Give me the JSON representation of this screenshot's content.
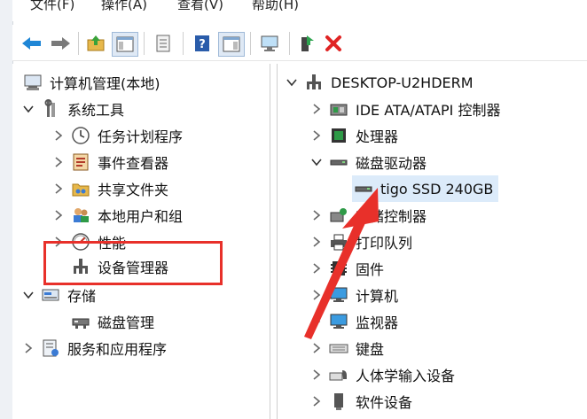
{
  "menu": {
    "items": [
      "文件(F)",
      "操作(A)",
      "查看(V)",
      "帮助(H)"
    ]
  },
  "toolbar": {
    "buttons": [
      "back-arrow-icon",
      "forward-arrow-icon",
      "up-folder-icon",
      "show-hide-tree-icon",
      "properties-icon",
      "help-icon",
      "action-pane-icon",
      "monitor-icon",
      "enable-icon",
      "delete-icon"
    ]
  },
  "left_tree": {
    "root": "计算机管理(本地)",
    "system_tools": "系统工具",
    "task_scheduler": "任务计划程序",
    "event_viewer": "事件查看器",
    "shared_folders": "共享文件夹",
    "local_users": "本地用户和组",
    "performance": "性能",
    "device_manager": "设备管理器",
    "storage": "存储",
    "disk_management": "磁盘管理",
    "services_apps": "服务和应用程序"
  },
  "right_tree": {
    "computer": "DESKTOP-U2HDERM",
    "ide": "IDE ATA/ATAPI 控制器",
    "processor": "处理器",
    "disk_drives": "磁盘驱动器",
    "disk_item": "tigo SSD 240GB",
    "storage_ctrl": "存储控制器",
    "print_queue": "打印队列",
    "firmware": "固件",
    "computer_cat": "计算机",
    "monitor": "监视器",
    "keyboard": "键盘",
    "hid": "人体学输入设备",
    "software_dev": "软件设备"
  },
  "colors": {
    "highlight_box": "#e8302a",
    "selection": "#dcebfa"
  }
}
